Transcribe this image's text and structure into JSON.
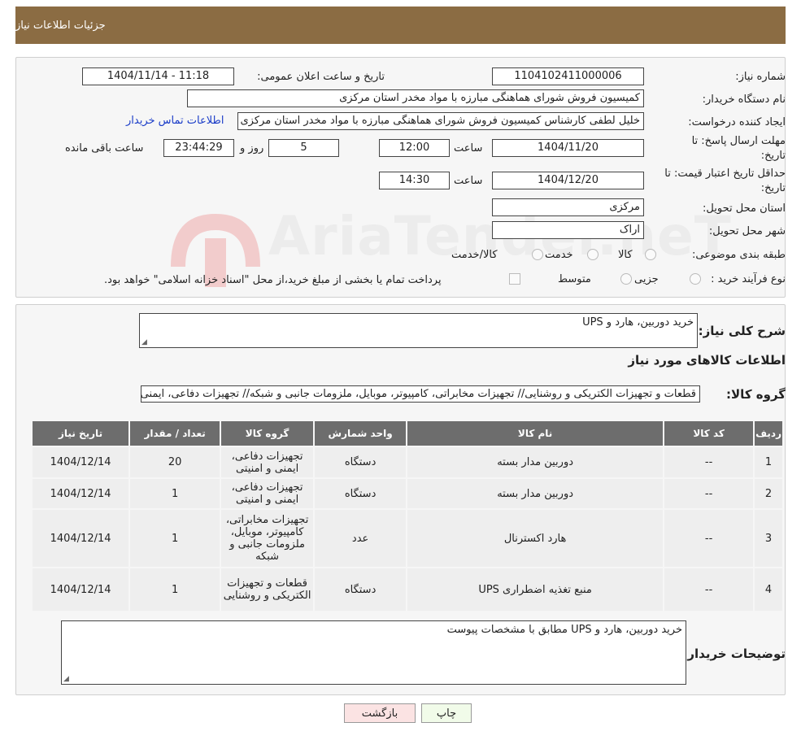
{
  "header": {
    "title": "جزئیات اطلاعات نیاز"
  },
  "form": {
    "need_number_label": "شماره نیاز:",
    "need_number": "1104102411000006",
    "announce_label": "تاریخ و ساعت اعلان عمومی:",
    "announce_value": "1404/11/14 - 11:18",
    "buyer_org_label": "نام دستگاه خریدار:",
    "buyer_org": "کمیسیون فروش شورای هماهنگی مبارزه با مواد مخدر استان مرکزی",
    "requester_label": "ایجاد کننده درخواست:",
    "requester": "خلیل لطفی کارشناس کمیسیون فروش شورای هماهنگی مبارزه با مواد مخدر استان مرکزی",
    "contact_link": "اطلاعات تماس خریدار",
    "reply_deadline_label_1": "مهلت ارسال پاسخ: تا",
    "reply_deadline_label_2": "تاریخ:",
    "reply_date": "1404/11/20",
    "time_word": "ساعت",
    "reply_time": "12:00",
    "days_value": "5",
    "days_word": "روز و",
    "remaining_time": "23:44:29",
    "remaining_word": "ساعت باقی مانده",
    "validity_label_1": "حداقل تاریخ اعتبار قیمت: تا",
    "validity_label_2": "تاریخ:",
    "validity_date": "1404/12/20",
    "validity_time": "14:30",
    "province_label": "استان محل تحویل:",
    "province": "مرکزی",
    "city_label": "شهر محل تحویل:",
    "city": "اراک",
    "category_label": "طبقه بندی موضوعی:",
    "category_options": [
      "کالا",
      "خدمت",
      "کالا/خدمت"
    ],
    "process_label": "نوع فرآیند خرید :",
    "process_options": [
      "جزیی",
      "متوسط"
    ],
    "payment_note": "پرداخت تمام یا بخشی از مبلغ خرید،از محل \"اسناد خزانه اسلامی\" خواهد بود."
  },
  "summary": {
    "label": "شرح کلی نیاز:",
    "text": "خرید دوربین، هارد و UPS",
    "goods_info_title": "اطلاعات کالاهای مورد نیاز",
    "group_label": "گروه کالا:",
    "group_value": "قطعات و تجهیزات الکتریکی و روشنایی// تجهیزات مخابراتی، کامپیوتر، موبایل، ملزومات جانبی و شبکه// تجهیزات دفاعی، ایمنی و امنیتی"
  },
  "table": {
    "headers": [
      "ردیف",
      "کد کالا",
      "نام کالا",
      "واحد شمارش",
      "گروه کالا",
      "تعداد / مقدار",
      "تاریخ نیاز"
    ],
    "rows": [
      [
        "1",
        "--",
        "دوربین مدار بسته",
        "دستگاه",
        "تجهیزات دفاعی، ایمنی و امنیتی",
        "20",
        "1404/12/14"
      ],
      [
        "2",
        "--",
        "دوربین مدار بسته",
        "دستگاه",
        "تجهیزات دفاعی، ایمنی و امنیتی",
        "1",
        "1404/12/14"
      ],
      [
        "3",
        "--",
        "هارد اکسترنال",
        "عدد",
        "تجهیزات مخابراتی، کامپیوتر، موبایل، ملزومات جانبی و شبکه",
        "1",
        "1404/12/14"
      ],
      [
        "4",
        "--",
        "منبع تغذیه اضطراری UPS",
        "دستگاه",
        "قطعات و تجهیزات الکتریکی و روشنایی",
        "1",
        "1404/12/14"
      ]
    ]
  },
  "buyer_notes": {
    "label": "توضیحات خریدار:",
    "text": "خرید دوربین، هارد و UPS مطابق با مشخصات پیوست"
  },
  "buttons": {
    "print": "چاپ",
    "back": "بازگشت"
  },
  "watermark": {
    "text": "AriaTender.neT"
  },
  "colors": {
    "header": "#8b6c43",
    "link": "#1a3cc8",
    "table_header": "#6d6d6d",
    "back_button": "#fbe3e3",
    "print_button": "#f1fbe9"
  }
}
